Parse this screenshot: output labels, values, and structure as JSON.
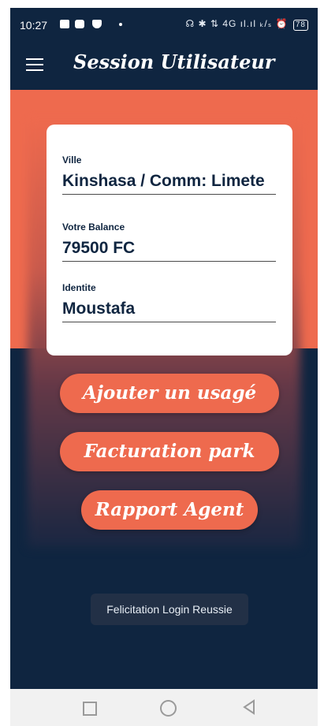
{
  "status_bar": {
    "time": "10:27",
    "right_text": "☊ ✱ ⇅ 4G ıl.ıl ₖ/ₛ ⏰",
    "battery": "78"
  },
  "app_bar": {
    "title": "Session Utilisateur",
    "menu_icon": "hamburger-menu-icon"
  },
  "card": {
    "fields": [
      {
        "label": "Ville",
        "value": "Kinshasa / Comm: Limete"
      },
      {
        "label": "Votre Balance",
        "value": "79500 FC"
      },
      {
        "label": "Identite",
        "value": "Moustafa"
      }
    ]
  },
  "actions": {
    "add_user": "Ajouter un usagé",
    "billing": "Facturation park",
    "report": "Rapport Agent"
  },
  "toast": "Felicitation Login Reussie",
  "colors": {
    "primary_dark": "#0f2540",
    "accent": "#ee6a4e",
    "card_bg": "#ffffff"
  },
  "nav_bar": {
    "icons": [
      "recent-apps-icon",
      "home-icon",
      "back-icon"
    ]
  }
}
